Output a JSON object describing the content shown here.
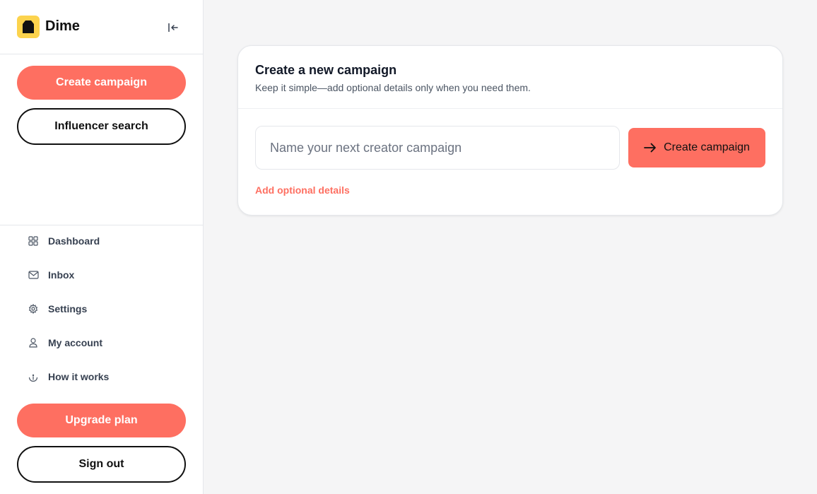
{
  "brand": {
    "name": "Dime"
  },
  "sidebar": {
    "primary_button": "Create campaign",
    "secondary_button": "Influencer search",
    "nav": [
      {
        "label": "Dashboard",
        "icon": "grid-icon"
      },
      {
        "label": "Inbox",
        "icon": "mail-icon"
      },
      {
        "label": "Settings",
        "icon": "gear-icon"
      },
      {
        "label": "My account",
        "icon": "user-icon"
      },
      {
        "label": "How it works",
        "icon": "info-icon"
      }
    ],
    "upgrade_button": "Upgrade plan",
    "signout_button": "Sign out"
  },
  "card": {
    "title": "Create a new campaign",
    "subtitle": "Keep it simple—add optional details only when you need them.",
    "input_placeholder": "Name your next creator campaign",
    "input_value": "",
    "create_button": "Create campaign",
    "optional_link": "Add optional details"
  },
  "colors": {
    "accent": "#fe6f61",
    "logo_bg": "#fcd34d"
  }
}
